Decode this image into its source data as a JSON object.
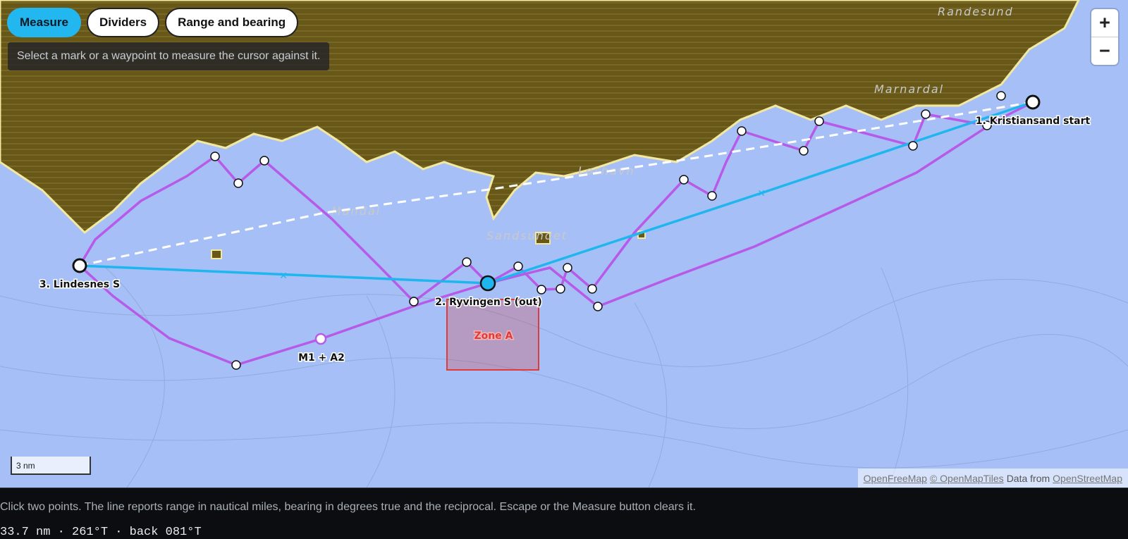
{
  "toolbar": {
    "buttons": [
      {
        "label": "Measure",
        "active": true
      },
      {
        "label": "Dividers",
        "active": false
      },
      {
        "label": "Range and bearing",
        "active": false
      }
    ]
  },
  "hint": "Select a mark or a waypoint to measure the cursor against it.",
  "zoom": {
    "in_label": "+",
    "out_label": "−"
  },
  "scale": {
    "label": "3 nm"
  },
  "attribution": {
    "a": "OpenFreeMap",
    "b": "© OpenMapTiles",
    "c": "Data from",
    "d": "OpenStreetMap"
  },
  "waypoints": [
    {
      "label": "1. Kristiansand start"
    },
    {
      "label": "2. Ryvingen S (out)"
    },
    {
      "label": "3. Lindesnes S"
    }
  ],
  "mark_label": "M1 + A2",
  "zone": {
    "label": "Zone A",
    "color": "#e03b3b"
  },
  "place_names": [
    "Randesund",
    "Mandal",
    "Sandsundet",
    "Loshavn",
    "Marnardal"
  ],
  "colors": {
    "water": "#a6c0f7",
    "land": "#6b5a1c",
    "route": "#b85ae8",
    "measure": "#1fb6ef",
    "shore": "#f2e8a0"
  },
  "instructions": "Click two points. The line reports range in nautical miles, bearing in degrees true and the reciprocal. Escape or the Measure button clears it.",
  "readout": "33.7 nm · 261°T · back 081°T"
}
